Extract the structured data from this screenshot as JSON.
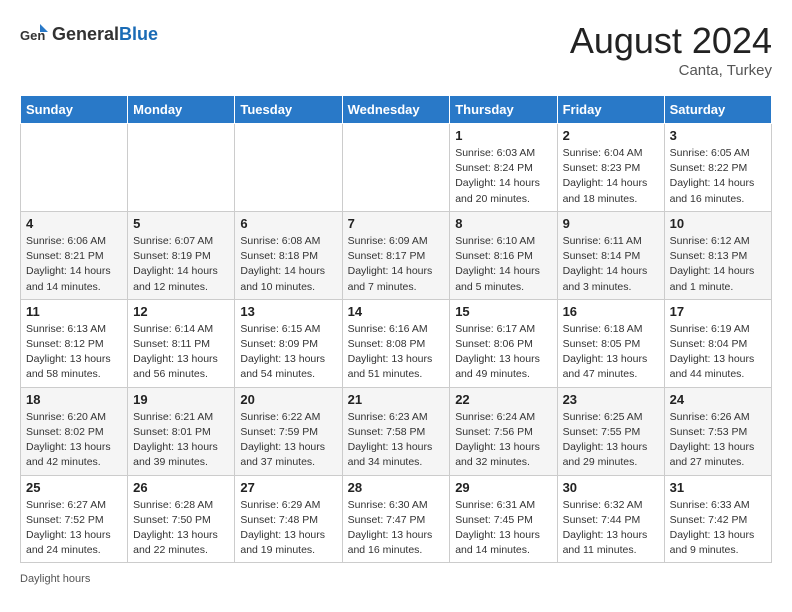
{
  "header": {
    "logo_general": "General",
    "logo_blue": "Blue",
    "month_year": "August 2024",
    "location": "Canta, Turkey"
  },
  "days_of_week": [
    "Sunday",
    "Monday",
    "Tuesday",
    "Wednesday",
    "Thursday",
    "Friday",
    "Saturday"
  ],
  "weeks": [
    [
      {
        "day": "",
        "info": ""
      },
      {
        "day": "",
        "info": ""
      },
      {
        "day": "",
        "info": ""
      },
      {
        "day": "",
        "info": ""
      },
      {
        "day": "1",
        "info": "Sunrise: 6:03 AM\nSunset: 8:24 PM\nDaylight: 14 hours\nand 20 minutes."
      },
      {
        "day": "2",
        "info": "Sunrise: 6:04 AM\nSunset: 8:23 PM\nDaylight: 14 hours\nand 18 minutes."
      },
      {
        "day": "3",
        "info": "Sunrise: 6:05 AM\nSunset: 8:22 PM\nDaylight: 14 hours\nand 16 minutes."
      }
    ],
    [
      {
        "day": "4",
        "info": "Sunrise: 6:06 AM\nSunset: 8:21 PM\nDaylight: 14 hours\nand 14 minutes."
      },
      {
        "day": "5",
        "info": "Sunrise: 6:07 AM\nSunset: 8:19 PM\nDaylight: 14 hours\nand 12 minutes."
      },
      {
        "day": "6",
        "info": "Sunrise: 6:08 AM\nSunset: 8:18 PM\nDaylight: 14 hours\nand 10 minutes."
      },
      {
        "day": "7",
        "info": "Sunrise: 6:09 AM\nSunset: 8:17 PM\nDaylight: 14 hours\nand 7 minutes."
      },
      {
        "day": "8",
        "info": "Sunrise: 6:10 AM\nSunset: 8:16 PM\nDaylight: 14 hours\nand 5 minutes."
      },
      {
        "day": "9",
        "info": "Sunrise: 6:11 AM\nSunset: 8:14 PM\nDaylight: 14 hours\nand 3 minutes."
      },
      {
        "day": "10",
        "info": "Sunrise: 6:12 AM\nSunset: 8:13 PM\nDaylight: 14 hours\nand 1 minute."
      }
    ],
    [
      {
        "day": "11",
        "info": "Sunrise: 6:13 AM\nSunset: 8:12 PM\nDaylight: 13 hours\nand 58 minutes."
      },
      {
        "day": "12",
        "info": "Sunrise: 6:14 AM\nSunset: 8:11 PM\nDaylight: 13 hours\nand 56 minutes."
      },
      {
        "day": "13",
        "info": "Sunrise: 6:15 AM\nSunset: 8:09 PM\nDaylight: 13 hours\nand 54 minutes."
      },
      {
        "day": "14",
        "info": "Sunrise: 6:16 AM\nSunset: 8:08 PM\nDaylight: 13 hours\nand 51 minutes."
      },
      {
        "day": "15",
        "info": "Sunrise: 6:17 AM\nSunset: 8:06 PM\nDaylight: 13 hours\nand 49 minutes."
      },
      {
        "day": "16",
        "info": "Sunrise: 6:18 AM\nSunset: 8:05 PM\nDaylight: 13 hours\nand 47 minutes."
      },
      {
        "day": "17",
        "info": "Sunrise: 6:19 AM\nSunset: 8:04 PM\nDaylight: 13 hours\nand 44 minutes."
      }
    ],
    [
      {
        "day": "18",
        "info": "Sunrise: 6:20 AM\nSunset: 8:02 PM\nDaylight: 13 hours\nand 42 minutes."
      },
      {
        "day": "19",
        "info": "Sunrise: 6:21 AM\nSunset: 8:01 PM\nDaylight: 13 hours\nand 39 minutes."
      },
      {
        "day": "20",
        "info": "Sunrise: 6:22 AM\nSunset: 7:59 PM\nDaylight: 13 hours\nand 37 minutes."
      },
      {
        "day": "21",
        "info": "Sunrise: 6:23 AM\nSunset: 7:58 PM\nDaylight: 13 hours\nand 34 minutes."
      },
      {
        "day": "22",
        "info": "Sunrise: 6:24 AM\nSunset: 7:56 PM\nDaylight: 13 hours\nand 32 minutes."
      },
      {
        "day": "23",
        "info": "Sunrise: 6:25 AM\nSunset: 7:55 PM\nDaylight: 13 hours\nand 29 minutes."
      },
      {
        "day": "24",
        "info": "Sunrise: 6:26 AM\nSunset: 7:53 PM\nDaylight: 13 hours\nand 27 minutes."
      }
    ],
    [
      {
        "day": "25",
        "info": "Sunrise: 6:27 AM\nSunset: 7:52 PM\nDaylight: 13 hours\nand 24 minutes."
      },
      {
        "day": "26",
        "info": "Sunrise: 6:28 AM\nSunset: 7:50 PM\nDaylight: 13 hours\nand 22 minutes."
      },
      {
        "day": "27",
        "info": "Sunrise: 6:29 AM\nSunset: 7:48 PM\nDaylight: 13 hours\nand 19 minutes."
      },
      {
        "day": "28",
        "info": "Sunrise: 6:30 AM\nSunset: 7:47 PM\nDaylight: 13 hours\nand 16 minutes."
      },
      {
        "day": "29",
        "info": "Sunrise: 6:31 AM\nSunset: 7:45 PM\nDaylight: 13 hours\nand 14 minutes."
      },
      {
        "day": "30",
        "info": "Sunrise: 6:32 AM\nSunset: 7:44 PM\nDaylight: 13 hours\nand 11 minutes."
      },
      {
        "day": "31",
        "info": "Sunrise: 6:33 AM\nSunset: 7:42 PM\nDaylight: 13 hours\nand 9 minutes."
      }
    ]
  ],
  "footer": {
    "label": "Daylight hours"
  }
}
